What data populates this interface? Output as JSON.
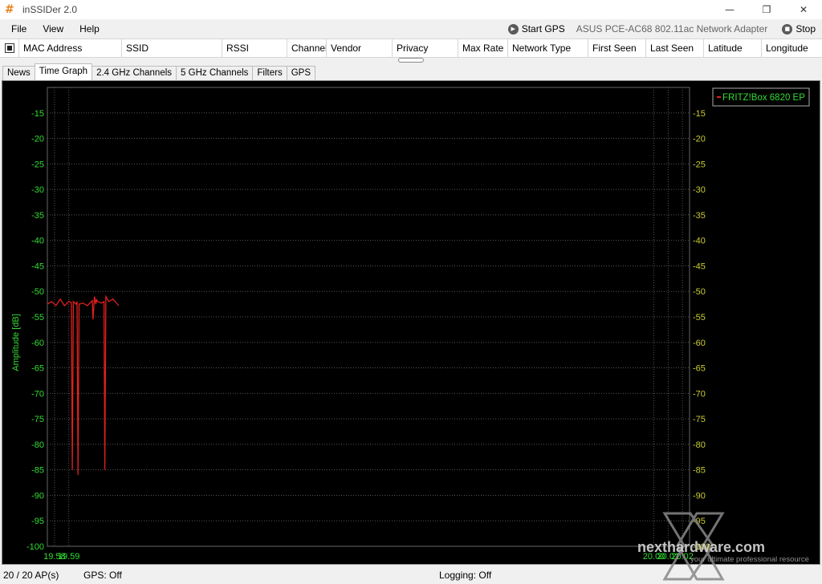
{
  "window": {
    "title": "inSSIDer 2.0",
    "icon": "hash-icon",
    "minimize_glyph": "—",
    "restore_glyph": "❐",
    "close_glyph": "✕"
  },
  "menu": {
    "items": [
      "File",
      "View",
      "Help"
    ],
    "start_gps": "Start GPS",
    "adapter": "ASUS PCE-AC68 802.11ac Network Adapter",
    "stop": "Stop"
  },
  "columns": [
    "MAC Address",
    "SSID",
    "RSSI",
    "Channel",
    "Vendor",
    "Privacy",
    "Max Rate",
    "Network Type",
    "First Seen",
    "Last Seen",
    "Latitude",
    "Longitude"
  ],
  "tabs": {
    "items": [
      "News",
      "Time Graph",
      "2.4 GHz Channels",
      "5 GHz Channels",
      "Filters",
      "GPS"
    ],
    "active": "Time Graph"
  },
  "chart_data": {
    "type": "line",
    "ylabel": "Amplitude [dB]",
    "ylim": [
      -100,
      -10
    ],
    "yticks": [
      "-15",
      "-20",
      "-25",
      "-30",
      "-35",
      "-40",
      "-45",
      "-50",
      "-55",
      "-60",
      "-65",
      "-70",
      "-75",
      "-80",
      "-85",
      "-90",
      "-95",
      "-100"
    ],
    "xlim": [
      19.575,
      20.025
    ],
    "xticks": [
      "19.58",
      "19.59",
      "20.00",
      "20.01",
      "20.02"
    ],
    "grid": true,
    "legend_placement": "top-right",
    "colors": {
      "axis_text": "#33dd33",
      "axis_text_right": "#cccc33",
      "series": "#e02020",
      "grid": "#555555",
      "background": "#000000"
    },
    "series": [
      {
        "name": "FRITZ!Box 6820 EP",
        "x": [
          19.575,
          19.578,
          19.581,
          19.584,
          19.587,
          19.59,
          19.5918,
          19.5925,
          19.5932,
          19.595,
          19.5958,
          19.5965,
          19.5972,
          19.6,
          19.603,
          19.6065,
          19.607,
          19.608,
          19.609,
          19.6095,
          19.61,
          19.613,
          19.6147,
          19.6153,
          19.616,
          19.618,
          19.621,
          19.625
        ],
        "y": [
          -52.5,
          -52.0,
          -52.8,
          -51.5,
          -52.8,
          -52.0,
          -52.2,
          -85.0,
          -52.0,
          -52.5,
          -52.0,
          -86.0,
          -52.5,
          -52.3,
          -52.8,
          -51.8,
          -55.5,
          -51.0,
          -52.5,
          -51.5,
          -52.0,
          -52.3,
          -52.0,
          -85.0,
          -51.0,
          -52.0,
          -51.5,
          -52.8
        ]
      }
    ]
  },
  "status": {
    "ap_count": "20 / 20 AP(s)",
    "gps": "GPS: Off",
    "logging": "Logging: Off"
  },
  "watermark": {
    "brand": "nexthardware.com",
    "tagline": "your ultimate professional resource"
  }
}
